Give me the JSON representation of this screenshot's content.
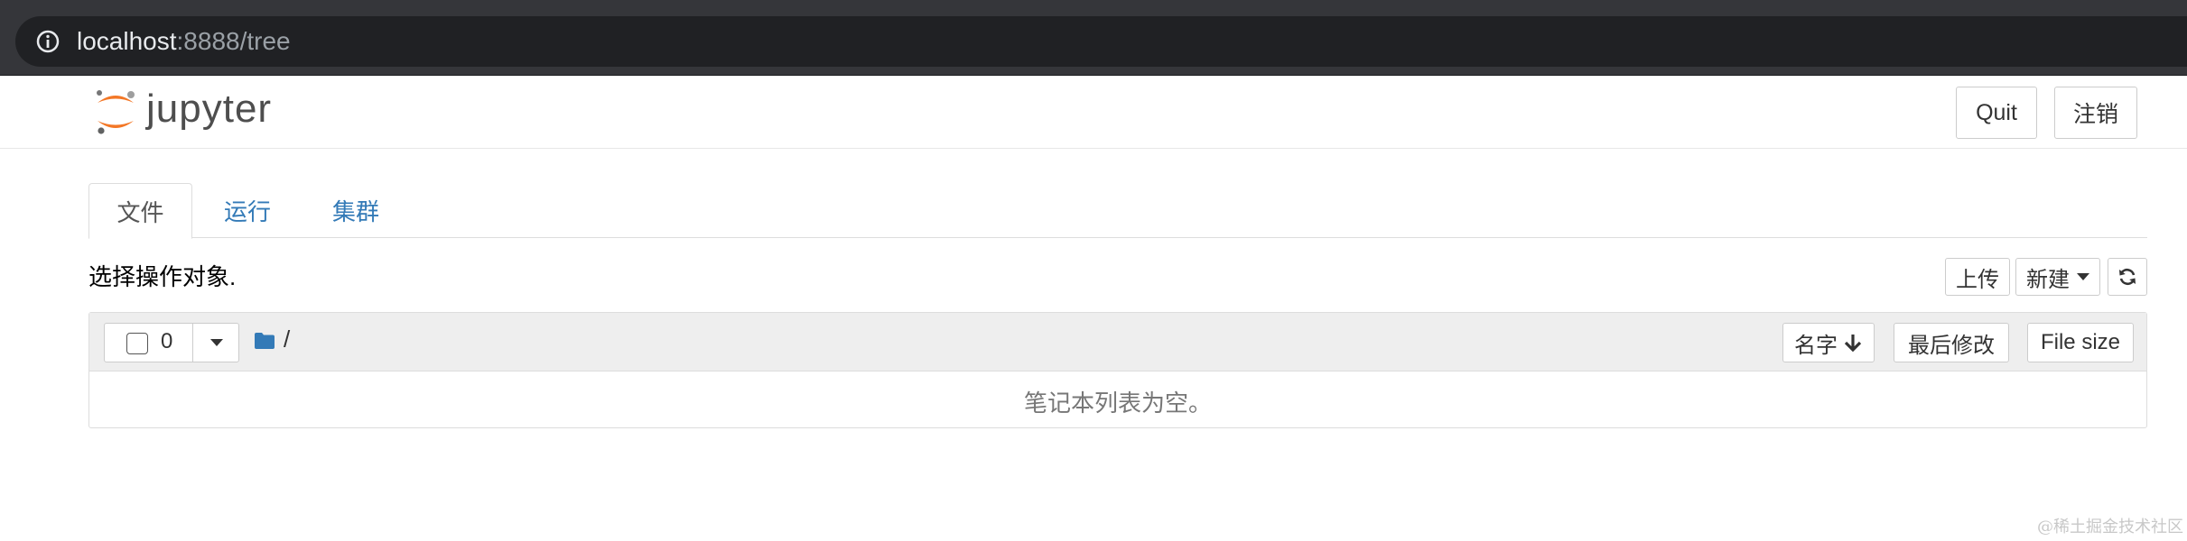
{
  "browser": {
    "url_host": "localhost",
    "url_rest": ":8888/tree"
  },
  "header": {
    "logo_text": "jupyter",
    "quit_label": "Quit",
    "logout_label": "注销"
  },
  "tabs": [
    {
      "label": "文件",
      "active": true
    },
    {
      "label": "运行",
      "active": false
    },
    {
      "label": "集群",
      "active": false
    }
  ],
  "toolbar": {
    "select_message": "选择操作对象.",
    "upload_label": "上传",
    "new_label": "新建"
  },
  "file_list": {
    "selected_count": "0",
    "path": "/",
    "sort_name_label": "名字",
    "sort_modified_label": "最后修改",
    "sort_size_label": "File size",
    "empty_message": "笔记本列表为空。"
  },
  "watermark": "@稀土掘金技术社区",
  "colors": {
    "link": "#337ab7",
    "jupyter_orange": "#f37726",
    "folder": "#337ab7",
    "browser_bar": "#35363a"
  },
  "icons": {
    "info": "info-icon",
    "folder": "folder-icon",
    "refresh": "refresh-icon",
    "sort_arrow": "arrow-down-icon"
  }
}
